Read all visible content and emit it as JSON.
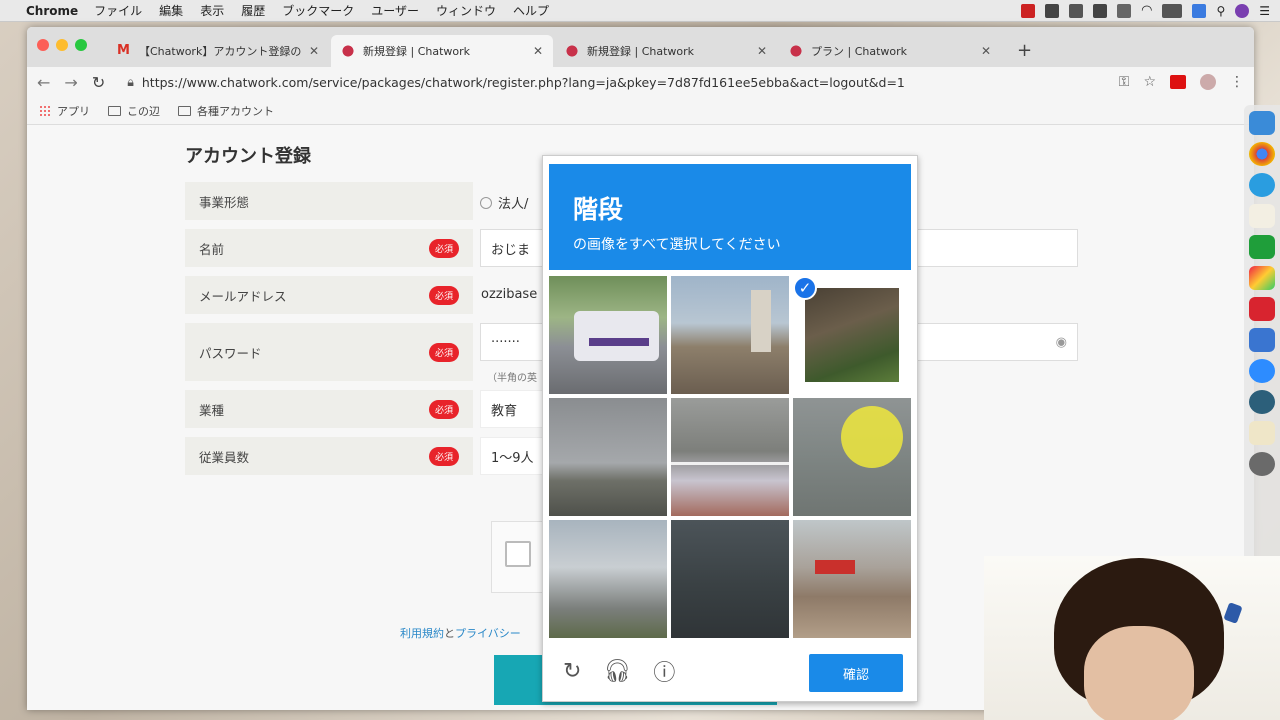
{
  "menubar": {
    "app": "Chrome",
    "items": [
      "ファイル",
      "編集",
      "表示",
      "履歴",
      "ブックマーク",
      "ユーザー",
      "ウィンドウ",
      "ヘルプ"
    ]
  },
  "tabs": [
    {
      "title": "【Chatwork】アカウント登録のご",
      "favicon": "gmail-icon"
    },
    {
      "title": "新規登録 | Chatwork",
      "favicon": "chatwork-icon"
    },
    {
      "title": "新規登録 | Chatwork",
      "favicon": "chatwork-icon"
    },
    {
      "title": "プラン | Chatwork",
      "favicon": "chatwork-icon"
    }
  ],
  "address_bar": {
    "url": "https://www.chatwork.com/service/packages/chatwork/register.php?lang=ja&pkey=7d87fd161ee5ebba&act=logout&d=1"
  },
  "bookmarks": [
    {
      "label": "アプリ",
      "icon": "apps-grid-icon"
    },
    {
      "label": "この辺",
      "icon": "folder-icon"
    },
    {
      "label": "各種アカウント",
      "icon": "folder-icon"
    }
  ],
  "form": {
    "title": "アカウント登録",
    "required_badge": "必須",
    "rows": {
      "business_type": {
        "label": "事業形態",
        "option": "法人/"
      },
      "name": {
        "label": "名前",
        "value": "おじま"
      },
      "email": {
        "label": "メールアドレス",
        "value": "ozzibase"
      },
      "password": {
        "label": "パスワード",
        "value": "·······",
        "hint": "（半角の英"
      },
      "industry": {
        "label": "業種",
        "value": "教育"
      },
      "employees": {
        "label": "従業員数",
        "value": "1〜9人"
      }
    },
    "terms": {
      "link1": "利用規約",
      "conj": "と",
      "link2": "プライバシー"
    }
  },
  "captcha": {
    "keyword": "階段",
    "instruction": "の画像をすべて選択してください",
    "verify_label": "確認",
    "tiles": [
      {
        "scene": "bus on street",
        "selected": false
      },
      {
        "scene": "house with chimney",
        "selected": false
      },
      {
        "scene": "outdoor stairs with railing",
        "selected": true
      },
      {
        "scene": "water tower under cloudy sky",
        "selected": false
      },
      {
        "scene": "porch with white fence",
        "selected": false
      },
      {
        "scene": "guardrail with yellow blur",
        "selected": false
      },
      {
        "scene": "house with porch steps",
        "selected": false
      },
      {
        "scene": "dark metal stairs",
        "selected": false
      },
      {
        "scene": "junk pile on lot",
        "selected": false
      }
    ]
  },
  "colors": {
    "captcha_blue": "#1a8ae8",
    "required_red": "#e8232a",
    "link_blue": "#2a88c8",
    "teal": "#17a7b4"
  }
}
